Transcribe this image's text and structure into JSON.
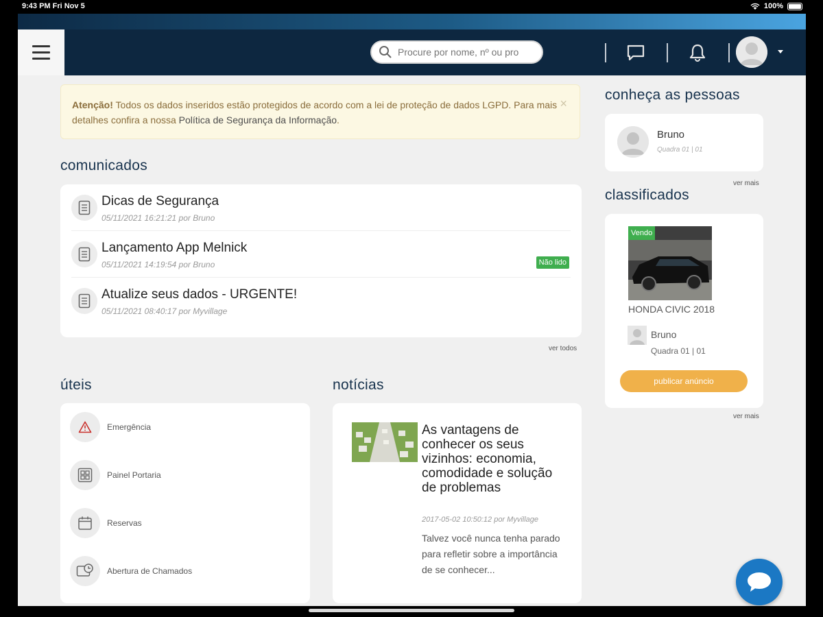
{
  "status_bar": {
    "time": "9:43 PM   Fri Nov 5",
    "battery": "100%"
  },
  "header": {
    "search_placeholder": "Procure por nome, nº ou pro",
    "icons": [
      "menu-icon",
      "search-icon",
      "chat-icon",
      "bell-icon",
      "avatar",
      "caret-down-icon"
    ]
  },
  "alert": {
    "strong": "Atenção!",
    "text": " Todos os dados inseridos estão protegidos de acordo com a lei de proteção de dados LGPD. Para mais detalhes confira a nossa ",
    "link": "Política de Segurança da Informação",
    "end": ".",
    "close": "×"
  },
  "comunicados": {
    "title": "comunicados",
    "items": [
      {
        "title": "Dicas de Segurança",
        "meta": "05/11/2021 16:21:21 por Bruno",
        "badge": ""
      },
      {
        "title": "Lançamento App Melnick",
        "meta": "05/11/2021 14:19:54 por Bruno",
        "badge": "Não lido"
      },
      {
        "title": "Atualize seus dados - URGENTE!",
        "meta": "05/11/2021 08:40:17 por Myvillage",
        "badge": ""
      }
    ],
    "ver_todos": "ver todos"
  },
  "uteis": {
    "title": "úteis",
    "items": [
      {
        "label": "Emergência",
        "icon": "warning-icon"
      },
      {
        "label": "Painel Portaria",
        "icon": "panel-icon"
      },
      {
        "label": "Reservas",
        "icon": "calendar-icon"
      },
      {
        "label": "Abertura de Chamados",
        "icon": "ticket-clock-icon"
      }
    ]
  },
  "noticias": {
    "title": "notícias",
    "item": {
      "title": "As vantagens de conhecer os seus vizinhos: economia, comodidade e solução de problemas",
      "meta": "2017-05-02 10:50:12 por Myvillage",
      "body": "Talvez você nunca tenha parado para refletir sobre a importância de se conhecer..."
    }
  },
  "pessoas": {
    "title": "conheça as pessoas",
    "person": {
      "name": "Bruno",
      "sub": "Quadra 01 | 01"
    },
    "ver_mais": "ver mais"
  },
  "classificados": {
    "title": "classificados",
    "item": {
      "tag": "Vendo",
      "title": "HONDA CIVIC 2018",
      "seller": "Bruno",
      "seller_sub": "Quadra 01 | 01"
    },
    "publish": "publicar anúncio",
    "ver_mais": "ver mais"
  },
  "colors": {
    "header_bg": "#0d2740",
    "accent_green": "#3fae4e",
    "accent_orange": "#f0b14a",
    "fab_blue": "#1b78c4"
  }
}
